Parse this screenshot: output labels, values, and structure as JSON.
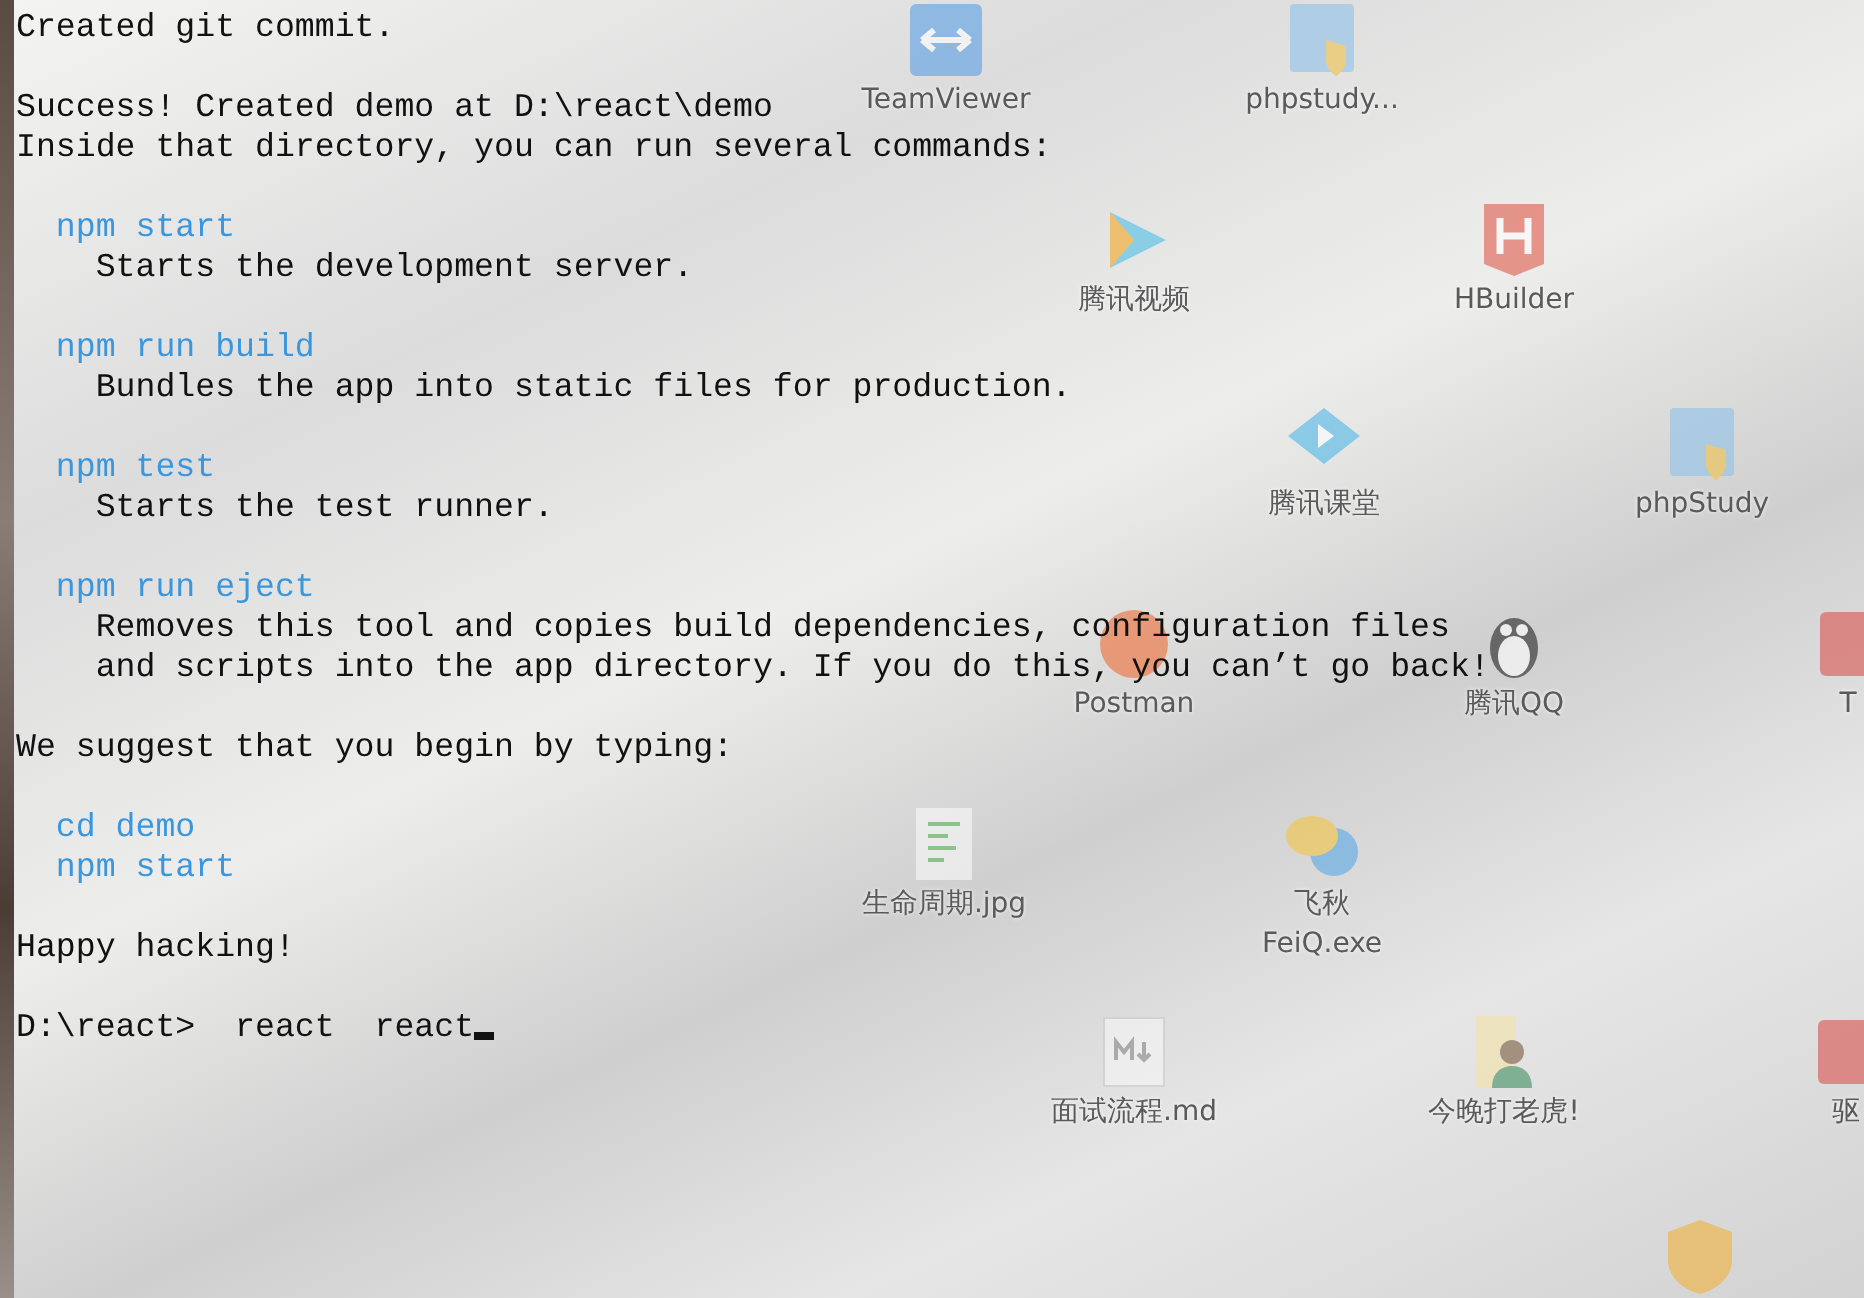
{
  "terminal": {
    "lines": [
      {
        "kind": "plain",
        "text": "Created git commit."
      },
      {
        "kind": "blank"
      },
      {
        "kind": "plain",
        "text": "Success! Created demo at D:\\react\\demo"
      },
      {
        "kind": "plain",
        "text": "Inside that directory, you can run several commands:"
      },
      {
        "kind": "blank"
      },
      {
        "kind": "command",
        "text": "  npm start"
      },
      {
        "kind": "plain",
        "text": "    Starts the development server."
      },
      {
        "kind": "blank"
      },
      {
        "kind": "command",
        "text": "  npm run build"
      },
      {
        "kind": "plain",
        "text": "    Bundles the app into static files for production."
      },
      {
        "kind": "blank"
      },
      {
        "kind": "command",
        "text": "  npm test"
      },
      {
        "kind": "plain",
        "text": "    Starts the test runner."
      },
      {
        "kind": "blank"
      },
      {
        "kind": "command",
        "text": "  npm run eject"
      },
      {
        "kind": "plain",
        "text": "    Removes this tool and copies build dependencies, configuration files"
      },
      {
        "kind": "plain",
        "text": "    and scripts into the app directory. If you do this, you can’t go back!"
      },
      {
        "kind": "blank"
      },
      {
        "kind": "plain",
        "text": "We suggest that you begin by typing:"
      },
      {
        "kind": "blank"
      },
      {
        "kind": "command",
        "text": "  cd demo"
      },
      {
        "kind": "command",
        "text": "  npm start"
      },
      {
        "kind": "blank"
      },
      {
        "kind": "plain",
        "text": "Happy hacking!"
      },
      {
        "kind": "blank"
      },
      {
        "kind": "prompt",
        "text": "D:\\react>  react  react",
        "cursor": true
      }
    ]
  },
  "desktop_icons": [
    {
      "kind": "remote",
      "label": [
        "TeamViewer"
      ]
    },
    {
      "kind": "server",
      "label": [
        "phpstudy..."
      ]
    },
    {
      "kind": "video",
      "label": [
        "腾讯视频"
      ]
    },
    {
      "kind": "editor",
      "label": [
        "HBuilder"
      ]
    },
    {
      "kind": "classroom",
      "label": [
        "腾讯课堂"
      ]
    },
    {
      "kind": "server",
      "label": [
        "phpStudy"
      ]
    },
    {
      "kind": "rocket",
      "label": [
        "Postman"
      ]
    },
    {
      "kind": "penguin",
      "label": [
        "腾讯QQ"
      ]
    },
    {
      "kind": "partial",
      "label": [
        "T"
      ]
    },
    {
      "kind": "image",
      "label": [
        "生命周期.jpg"
      ]
    },
    {
      "kind": "chat",
      "label": [
        "飞秋",
        "FeiQ.exe"
      ]
    },
    {
      "kind": "markdown",
      "label": [
        "面试流程.md"
      ]
    },
    {
      "kind": "folder",
      "label": [
        "今晚打老虎!"
      ]
    },
    {
      "kind": "partial",
      "label": [
        "驱"
      ]
    },
    {
      "kind": "shield"
    }
  ]
}
